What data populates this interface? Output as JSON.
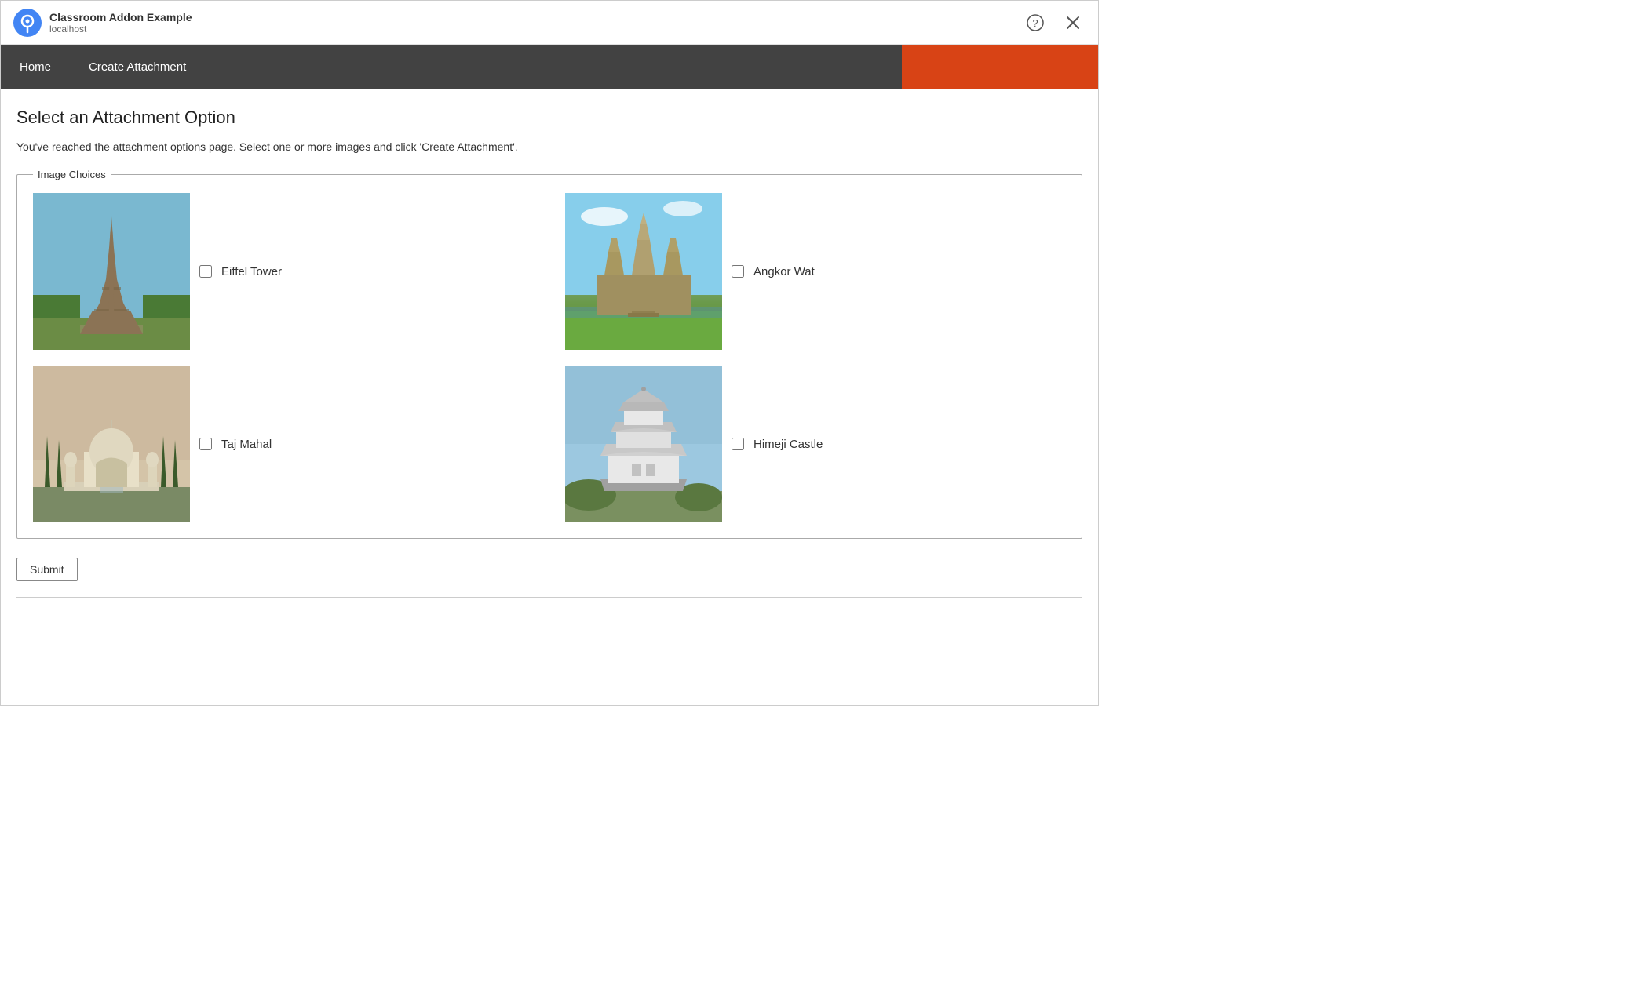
{
  "titleBar": {
    "appTitle": "Classroom Addon Example",
    "appSubtitle": "localhost",
    "helpButtonLabel": "?",
    "closeButtonLabel": "×"
  },
  "navBar": {
    "homeLabel": "Home",
    "createAttachmentLabel": "Create Attachment"
  },
  "main": {
    "pageHeading": "Select an Attachment Option",
    "pageDescription": "You've reached the attachment options page. Select one or more images and click 'Create Attachment'.",
    "fieldsetLegend": "Image Choices",
    "images": [
      {
        "id": "eiffel",
        "label": "Eiffel Tower",
        "checked": false
      },
      {
        "id": "angkor",
        "label": "Angkor Wat",
        "checked": false
      },
      {
        "id": "tajmahal",
        "label": "Taj Mahal",
        "checked": false
      },
      {
        "id": "himeji",
        "label": "Himeji Castle",
        "checked": false
      }
    ],
    "submitLabel": "Submit"
  }
}
